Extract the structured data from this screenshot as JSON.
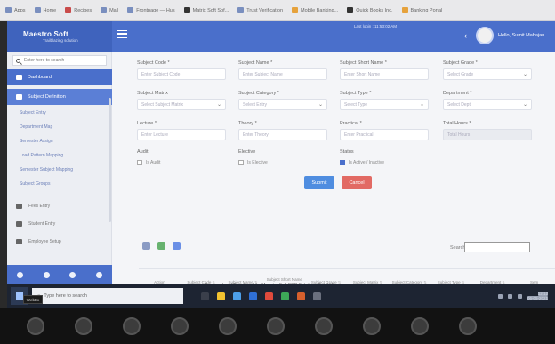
{
  "browser": {
    "bookmarks": [
      "Apps",
      "Home",
      "Recipes",
      "Mail",
      "Frontpage — Hus",
      "Matrix Soft Sof...",
      "Trust Verification",
      "Mobile Banking...",
      "Quick Books Inc.",
      "Banking Portal"
    ]
  },
  "header": {
    "brand_name": "Maestro Soft",
    "brand_tag": "Trailblazing solution",
    "top_message": "Last login : 11:53:02 AM",
    "user_name": "Hello, Sumit Mahajan"
  },
  "sidebar": {
    "search_placeholder": "Enter here to search",
    "items": [
      {
        "label": "Dashboard"
      },
      {
        "label": "Subject Definition"
      }
    ],
    "sub_items": [
      {
        "label": "Subject Entry"
      },
      {
        "label": "Department Map"
      },
      {
        "label": "Semester Assign"
      },
      {
        "label": "Load Pattern Mapping"
      },
      {
        "label": "Semester Subject Mapping"
      },
      {
        "label": "Subject Groups"
      }
    ],
    "plain_items": [
      {
        "label": "Fees Entry"
      },
      {
        "label": "Student Entry"
      },
      {
        "label": "Employee Setup"
      }
    ]
  },
  "form": {
    "subject_code": {
      "label": "Subject Code *",
      "placeholder": "Enter Subject Code"
    },
    "subject_name": {
      "label": "Subject Name *",
      "placeholder": "Enter Subject Name"
    },
    "subject_short_name": {
      "label": "Subject Short Name *",
      "placeholder": "Enter Short Name"
    },
    "subject_grade": {
      "label": "Subject Grade *",
      "placeholder": "Select Grade"
    },
    "subject_matrix": {
      "label": "Subject Matrix",
      "placeholder": "Select Subject Matrix"
    },
    "subject_category": {
      "label": "Subject Category *",
      "value": "Select Entry"
    },
    "subject_type": {
      "label": "Subject Type *",
      "value": "Select Type"
    },
    "department": {
      "label": "Department *",
      "value": "Select Dept"
    },
    "lecture": {
      "label": "Lecture *",
      "placeholder": "Enter Lecture"
    },
    "theory": {
      "label": "Theory *",
      "placeholder": "Enter Theory"
    },
    "practical": {
      "label": "Practical *",
      "placeholder": "Enter Practical"
    },
    "total_hours": {
      "label": "Total Hours *",
      "placeholder": "Total Hours"
    },
    "audit": {
      "label": "Audit",
      "check_label": "Is Audit"
    },
    "elective": {
      "label": "Elective",
      "check_label": "Is Elective"
    },
    "status": {
      "label": "Status",
      "check_label": "Is Active / Inactive"
    },
    "submit_label": "Submit",
    "cancel_label": "Cancel"
  },
  "table": {
    "search_label": "Search:",
    "columns": [
      "Action",
      "Subject Code",
      "Subject Name",
      "Subject Short Name",
      "Subject Grade",
      "Subject Matrix",
      "Subject Category",
      "Subject Type",
      "Department",
      "Sem"
    ]
  },
  "footer": {
    "note": "Designed and Developed by Maestro Soft ERP Solutions Pvt. Ltd."
  },
  "taskbar": {
    "search_placeholder": "Type here to search",
    "clock_time": "12:12",
    "clock_date": "06-05-2021"
  },
  "meeting": {
    "badge": "WebEx"
  }
}
